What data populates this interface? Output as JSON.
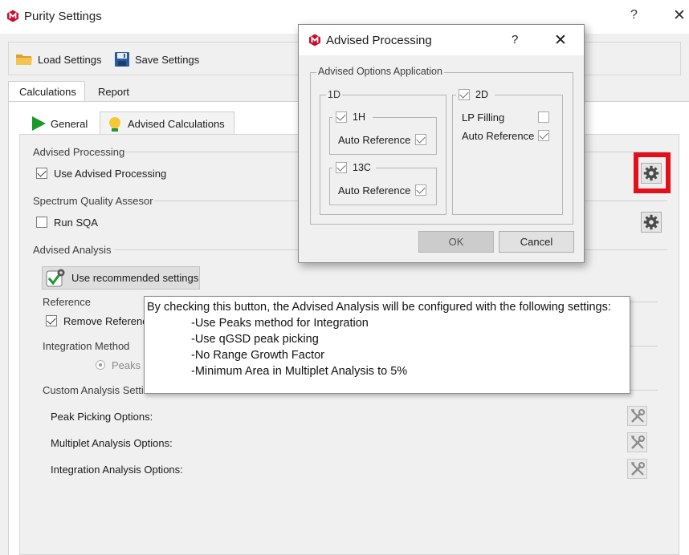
{
  "window": {
    "title": "Purity Settings",
    "help": "?",
    "close": "✕"
  },
  "toolbar": {
    "load_label": "Load Settings",
    "save_label": "Save Settings"
  },
  "tabs": {
    "calculations": "Calculations",
    "report": "Report"
  },
  "subtabs": {
    "general": "General",
    "advised": "Advised Calculations"
  },
  "advised_processing": {
    "title": "Advised Processing",
    "use_label": "Use Advised Processing",
    "use_checked": true
  },
  "sqa": {
    "title": "Spectrum Quality Assesor",
    "run_label": "Run SQA",
    "run_checked": false
  },
  "analysis": {
    "title": "Advised Analysis",
    "recommended_label": "Use recommended settings",
    "reference_title": "Reference",
    "remove_reference_label": "Remove Referenc",
    "integration_title": "Integration Method",
    "peaks_label": "Peaks",
    "custom_title": "Custom Analysis Setti",
    "peak_picking_label": "Peak Picking Options:",
    "multiplet_label": "Multiplet Analysis Options:",
    "integration_options_label": "Integration Analysis Options:"
  },
  "tooltip": {
    "heading": "By checking this button, the Advised Analysis will be configured with the following settings:",
    "lines": [
      "-Use Peaks method for Integration",
      "-Use qGSD peak picking",
      "-No Range Growth Factor",
      "-Minimum Area in Multiplet Analysis to 5%"
    ]
  },
  "dialog": {
    "title": "Advised Processing",
    "help": "?",
    "close": "✕",
    "group_title": "Advised Options Application",
    "one_d": "1D",
    "h1": "1H",
    "c13": "13C",
    "auto_ref_1h": "Auto Reference",
    "auto_ref_13c": "Auto Reference",
    "two_d": "2D",
    "lp_filling": "LP Filling",
    "auto_ref_2d": "Auto Reference",
    "ok": "OK",
    "cancel": "Cancel"
  },
  "colors": {
    "logo_red": "#c8102e",
    "highlight_red": "#e3101b",
    "play_green": "#1a9a2a",
    "folder_yellow": "#e8b43c",
    "disk_blue": "#2c5a9e"
  },
  "icons": [
    "app-logo-icon",
    "folder-icon",
    "floppy-disk-icon",
    "play-icon",
    "lightbulb-icon",
    "gear-icon",
    "recommended-check-icon",
    "wrench-screwdriver-icon"
  ]
}
